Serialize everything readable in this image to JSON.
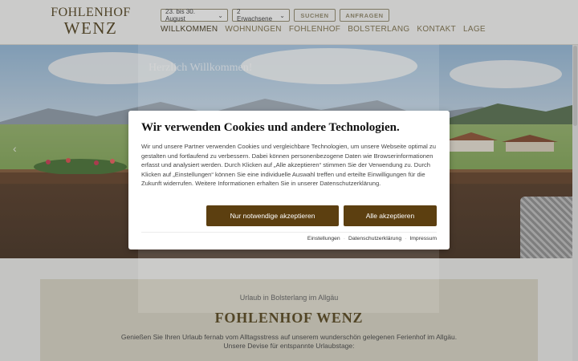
{
  "logo": {
    "line1": "FOHLENHOF",
    "line2": "WENZ"
  },
  "booking": {
    "dates": "23. bis 30. August",
    "guests": "2 Erwachsene",
    "search_label": "SUCHEN",
    "inquire_label": "ANFRAGEN"
  },
  "nav": [
    "WILLKOMMEN",
    "WOHNUNGEN",
    "FOHLENHOF",
    "BOLSTERLANG",
    "KONTAKT",
    "LAGE"
  ],
  "hero": {
    "title": "Herzlich Willkommen!"
  },
  "content": {
    "subtitle": "Urlaub in Bolsterlang im Allgäu",
    "title": "FOHLENHOF WENZ",
    "text": "Genießen Sie Ihren Urlaub fernab vom Alltagsstress auf unserem wunderschön gelegenen Ferienhof im Allgäu. Unsere Devise für entspannte Urlaubstage:"
  },
  "cookie": {
    "title": "Wir verwenden Cookies und andere Technologien.",
    "text": "Wir und unsere Partner verwenden Cookies und vergleichbare Technologien, um unsere Webseite optimal zu gestalten und fortlaufend zu verbessern. Dabei können personenbezogene Daten wie Browserinformationen erfasst und analysiert werden. Durch Klicken auf „Alle akzeptieren“ stimmen Sie der Verwendung zu. Durch Klicken auf „Einstellungen“ können Sie eine individuelle Auswahl treffen und erteilte Einwilligungen für die Zukunft widerrufen. Weitere Informationen erhalten Sie in unserer Datenschutzerklärung.",
    "btn_necessary": "Nur notwendige akzeptieren",
    "btn_all": "Alle akzeptieren",
    "links": [
      "Einstellungen",
      "Datenschutzerklärung",
      "Impressum"
    ]
  },
  "colors": {
    "brand": "#5c3f10",
    "nav_text": "#7a6d46",
    "content_bg": "#d8d5c4"
  }
}
